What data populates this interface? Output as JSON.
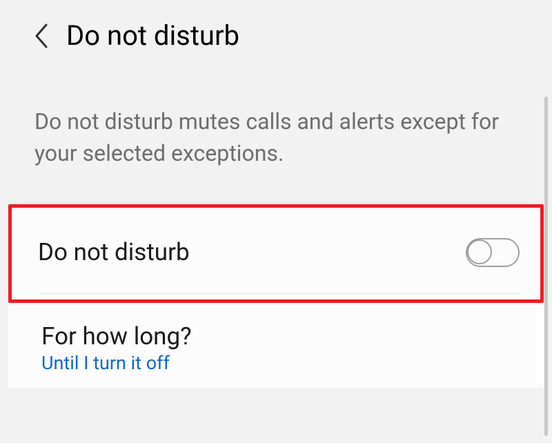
{
  "header": {
    "title": "Do not disturb"
  },
  "description": "Do not disturb mutes calls and alerts except for your selected exceptions.",
  "toggle": {
    "label": "Do not disturb"
  },
  "duration": {
    "label": "For how long?",
    "value": "Until I turn it off"
  }
}
